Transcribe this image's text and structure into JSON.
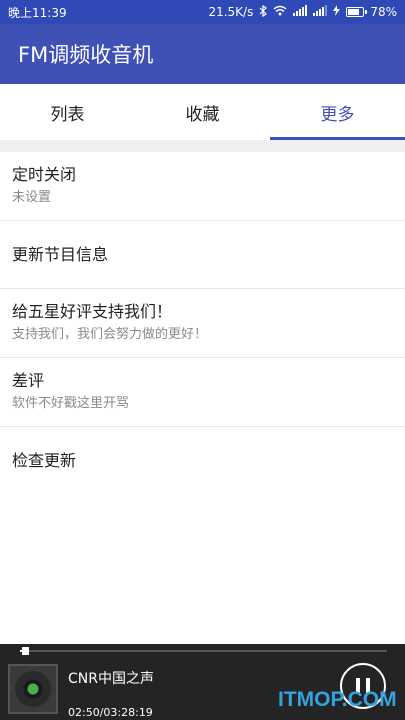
{
  "status_bar": {
    "time": "晚上11:39",
    "network_speed": "21.5K/s",
    "battery": "78%",
    "battery_level": 0.78,
    "icons": [
      "bluetooth-icon",
      "wifi-icon",
      "signal-icon",
      "signal-icon",
      "charging-icon"
    ]
  },
  "app_bar": {
    "title": "FM调频收音机"
  },
  "tabs": [
    {
      "label": "列表",
      "active": false
    },
    {
      "label": "收藏",
      "active": false
    },
    {
      "label": "更多",
      "active": true
    }
  ],
  "menu": [
    {
      "title": "定时关闭",
      "subtitle": "未设置"
    },
    {
      "title": "更新节目信息"
    },
    {
      "title": "给五星好评支持我们！",
      "subtitle": "支持我们，我们会努力做的更好！"
    },
    {
      "title": "差评",
      "subtitle": "软件不好戳这里开骂"
    },
    {
      "title": "检查更新"
    }
  ],
  "player": {
    "station": "CNR中国之声",
    "time": "02:50/03:28:19",
    "progress": 0.013,
    "icons": [
      "album-art-icon",
      "pause-icon"
    ]
  },
  "watermark": "ITMOP.COM",
  "colors": {
    "primary": "#3f51b5",
    "status_bar": "#2f49b6",
    "player_bg": "#242424",
    "watermark": "#35a2df"
  }
}
